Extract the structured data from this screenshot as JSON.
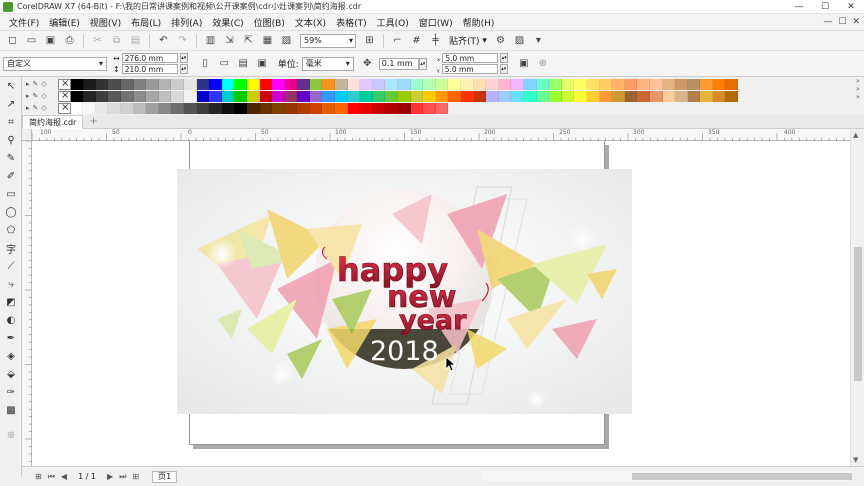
{
  "window": {
    "title": "CorelDRAW X7 (64-Bit) - F:\\我的日常讲课案例和视频\\公开课案例\\cdr小灶课案列\\简约海报.cdr",
    "minimize": "—",
    "maximize": "☐",
    "close": "✕"
  },
  "menu": {
    "items": [
      "文件(F)",
      "编辑(E)",
      "视图(V)",
      "布局(L)",
      "排列(A)",
      "效果(C)",
      "位图(B)",
      "文本(X)",
      "表格(T)",
      "工具(O)",
      "窗口(W)",
      "帮助(H)"
    ],
    "right_controls": [
      "—",
      "☐",
      "✕"
    ]
  },
  "toolbar": {
    "zoom_value": "59%",
    "snap_label": "贴齐(T)"
  },
  "property_bar": {
    "preset": "自定义",
    "width": "276.0 mm",
    "height": "210.0 mm",
    "unit_label": "单位:",
    "unit_value": "毫米",
    "nudge": "0.1 mm",
    "dup_x": "5.0 mm",
    "dup_y": "5.0 mm"
  },
  "document": {
    "tab_name": "简约海报.cdr",
    "page_label": "页1",
    "page_count": "1 / 1"
  },
  "ruler": {
    "h_labels": [
      "100",
      "50",
      "0",
      "50",
      "100",
      "150",
      "200",
      "250",
      "300",
      "350",
      "400"
    ],
    "v_labels": [
      "200",
      "150",
      "100",
      "50",
      "0",
      "50"
    ]
  },
  "poster": {
    "line1": "happy",
    "line2": "new",
    "line3": "year",
    "year": "2018"
  },
  "colors": {
    "accent": "#c4162e",
    "year_band": "#4a463a"
  },
  "palette": {
    "row1": [
      "#000000",
      "#1a1a1a",
      "#333333",
      "#4d4d4d",
      "#666666",
      "#808080",
      "#999999",
      "#b3b3b3",
      "#cccccc",
      "#e6e6e6",
      "#2e3192",
      "#0000ff",
      "#00ffff",
      "#00ff00",
      "#ffff00",
      "#ff0000",
      "#ff00ff",
      "#ec008c",
      "#662d91",
      "#8dc63f",
      "#f7941d",
      "#c2b59b",
      "#ffdede",
      "#e0c8ff",
      "#c8c8ff",
      "#a8e6ff",
      "#9bd9ff",
      "#99ffcc",
      "#b3ffb3",
      "#ccff99",
      "#ffff99",
      "#fff2b3",
      "#ffe0b3",
      "#ffd1d1",
      "#ffb3d9",
      "#f2b3ff",
      "#80d4ff",
      "#66ffcc",
      "#99ff66",
      "#e6ff66",
      "#ffff66",
      "#ffe066",
      "#ffcc66",
      "#ffb366",
      "#ff9966",
      "#ffb380",
      "#ffc299",
      "#e6b380",
      "#cc9966",
      "#b38f66",
      "#ff9933",
      "#ff8000",
      "#e66e00"
    ],
    "row2": [
      "#000000",
      "#262626",
      "#404040",
      "#595959",
      "#737373",
      "#8c8c8c",
      "#a6a6a6",
      "#bfbfbf",
      "#d9d9d9",
      "#f2f2f2",
      "#0000cc",
      "#3333ff",
      "#00cccc",
      "#00cc00",
      "#cccc00",
      "#cc0000",
      "#cc00cc",
      "#993366",
      "#6600cc",
      "#9966cc",
      "#3399ff",
      "#00ccff",
      "#33cccc",
      "#00cc99",
      "#33cc66",
      "#66cc33",
      "#99cc00",
      "#cccc33",
      "#ffcc00",
      "#ff9900",
      "#ff6600",
      "#ff3300",
      "#cc3300",
      "#b3b3ff",
      "#99ccff",
      "#66e0ff",
      "#33ffcc",
      "#66ff99",
      "#99ff33",
      "#ccff33",
      "#ffff33",
      "#ffcc33",
      "#ff9933",
      "#cc9933",
      "#996633",
      "#cc6633",
      "#e69966",
      "#ffcc99",
      "#d9b38c",
      "#b3804d",
      "#e6b33d",
      "#d98c26",
      "#b36b00"
    ],
    "row3": [
      "#ffffff",
      "#f7f7f7",
      "#e8e8e8",
      "#dcdcdc",
      "#cfcfcf",
      "#bcbcbc",
      "#a0a0a0",
      "#888888",
      "#6e6e6e",
      "#555555",
      "#3d3d3d",
      "#262626",
      "#111111",
      "#000000",
      "#4d2600",
      "#663300",
      "#804000",
      "#993300",
      "#b33c00",
      "#cc4400",
      "#e65c00",
      "#ff6600",
      "#ff0000",
      "#e60000",
      "#cc0000",
      "#b30000",
      "#990000",
      "#ff3333",
      "#ff4d4d",
      "#ff6666"
    ]
  }
}
